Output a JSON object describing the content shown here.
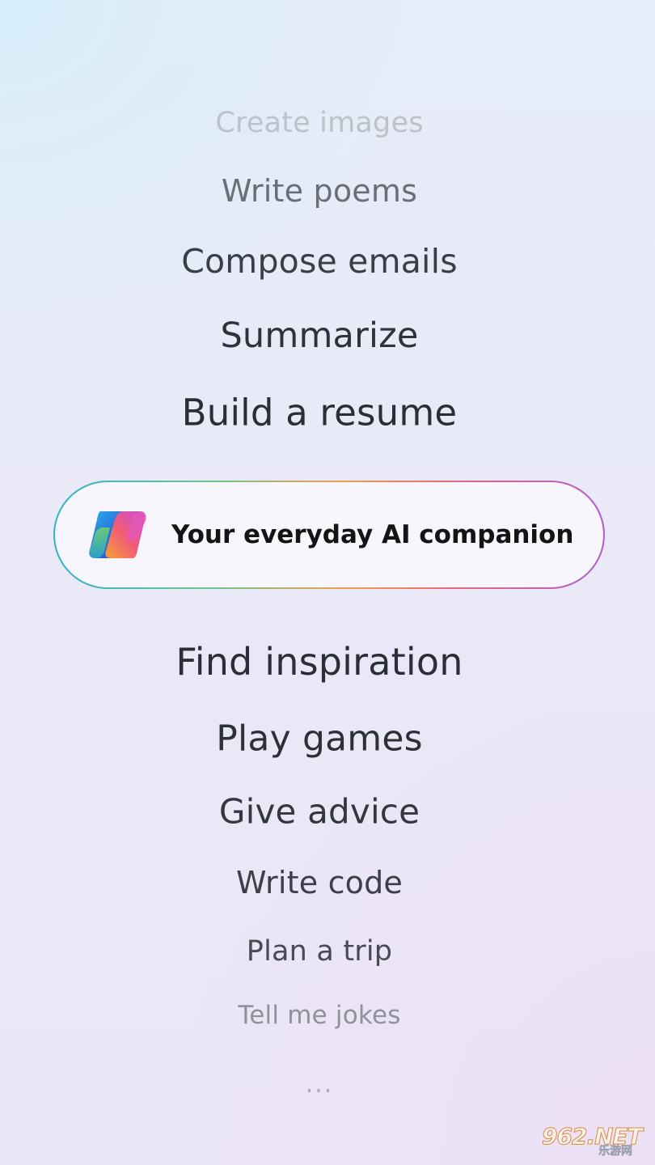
{
  "carousel": {
    "items_above": [
      {
        "label": "Create images"
      },
      {
        "label": "Write poems"
      },
      {
        "label": "Compose emails"
      },
      {
        "label": "Summarize"
      },
      {
        "label": "Build a resume"
      }
    ],
    "highlight": {
      "label": "Your everyday AI companion",
      "logo_icon": "copilot-logo-icon",
      "border_colors": [
        "#2fb3c8",
        "#6cc38f",
        "#f0a050",
        "#e46a7c",
        "#b05bd0"
      ]
    },
    "items_below": [
      {
        "label": "Find inspiration"
      },
      {
        "label": "Play games"
      },
      {
        "label": "Give advice"
      },
      {
        "label": "Write code"
      },
      {
        "label": "Plan a trip"
      },
      {
        "label": "Tell me jokes"
      }
    ],
    "more": "..."
  },
  "watermark": {
    "main": "962.NET",
    "sub": "乐游网"
  }
}
